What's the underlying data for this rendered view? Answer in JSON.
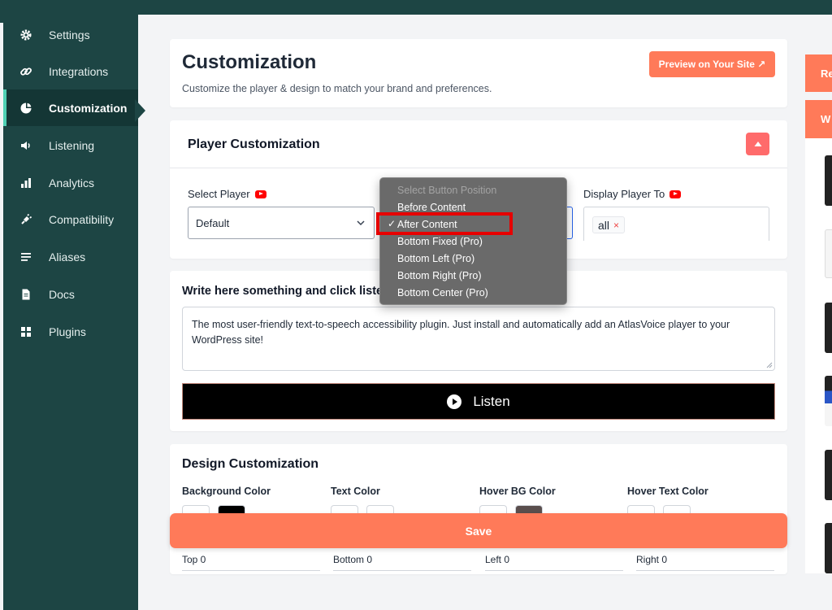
{
  "sidebar": {
    "items": [
      {
        "label": "Settings",
        "icon": "gear-icon"
      },
      {
        "label": "Integrations",
        "icon": "link-icon"
      },
      {
        "label": "Customization",
        "icon": "palette-icon",
        "active": true
      },
      {
        "label": "Listening",
        "icon": "speaker-icon"
      },
      {
        "label": "Analytics",
        "icon": "bar-chart-icon"
      },
      {
        "label": "Compatibility",
        "icon": "plug-icon"
      },
      {
        "label": "Aliases",
        "icon": "list-icon"
      },
      {
        "label": "Docs",
        "icon": "document-icon"
      },
      {
        "label": "Plugins",
        "icon": "grid-icon"
      }
    ]
  },
  "header": {
    "title": "Customization",
    "subtitle": "Customize the player & design to match your brand and preferences.",
    "preview_label": "Preview on Your Site ↗"
  },
  "player_customization": {
    "title": "Player Customization",
    "select_player_label": "Select Player",
    "select_player_value": "Default",
    "display_player_label": "Display Player To",
    "display_tags": [
      "all"
    ],
    "tag_remove": "×"
  },
  "button_position_dropdown": {
    "placeholder": "Select Button Position",
    "check_mark": "✓",
    "options": [
      {
        "label": "Before Content",
        "selected": false
      },
      {
        "label": "After Content",
        "selected": true
      },
      {
        "label": "Bottom Fixed (Pro)",
        "selected": false
      },
      {
        "label": "Bottom Left (Pro)",
        "selected": false
      },
      {
        "label": "Bottom Right (Pro)",
        "selected": false
      },
      {
        "label": "Bottom Center (Pro)",
        "selected": false
      }
    ]
  },
  "preview": {
    "title": "Write here something and click liste",
    "text": "The most user-friendly text-to-speech accessibility plugin. Just install and automatically add an AtlasVoice player to your WordPress site!",
    "listen_label": "Listen"
  },
  "design": {
    "title": "Design Customization",
    "color_labels": [
      "Background Color",
      "Text Color",
      "Hover BG Color",
      "Hover Text Color"
    ],
    "padding_labels": [
      "Top 0",
      "Bottom 0",
      "Left 0",
      "Right 0"
    ]
  },
  "save_label": "Save",
  "right_panel": {
    "top_label": "Re",
    "second_label": "W"
  },
  "colors": {
    "accent": "#ff7a59",
    "sidebar": "#1d4544",
    "highlight": "#e60000"
  }
}
